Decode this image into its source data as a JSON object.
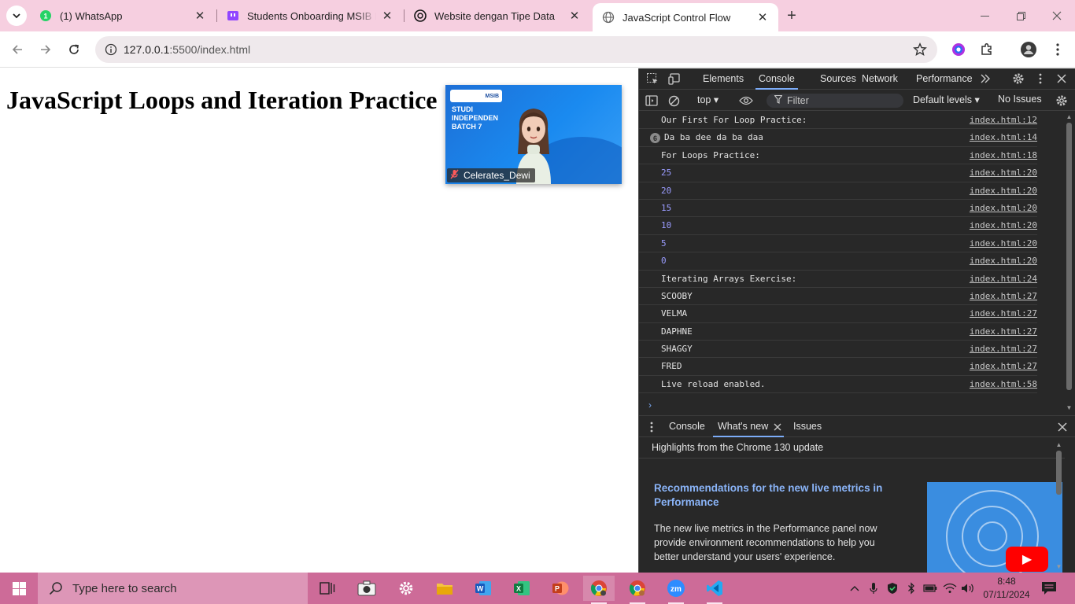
{
  "browser": {
    "tabs": [
      {
        "title": "(1) WhatsApp",
        "icon": "whatsapp-icon"
      },
      {
        "title": "Students Onboarding MSIB Bat",
        "icon": "twitch-icon"
      },
      {
        "title": "Website dengan Tipe Data",
        "icon": "openai-icon"
      },
      {
        "title": "JavaScript Control Flow",
        "icon": "globe-icon",
        "active": true
      }
    ],
    "whatsapp_badge": "1",
    "url_host": "127.0.0.1",
    "url_path": ":5500/index.html"
  },
  "page": {
    "heading": "JavaScript Loops and Iteration Practice",
    "video": {
      "logo_text": "MSIB",
      "banner_text": "STUDI\nINDEPENDEN\nBATCH 7",
      "participant_name": "Celerates_Dewi"
    }
  },
  "devtools": {
    "panel_tabs": [
      "Elements",
      "Console",
      "Sources",
      "Network",
      "Performance"
    ],
    "active_tab": "Console",
    "context": "top",
    "filter_placeholder": "Filter",
    "levels": "Default levels",
    "issues": "No Issues",
    "logs": [
      {
        "msg": "Our First For Loop Practice:",
        "src": "index.html:12"
      },
      {
        "msg": "Da ba dee da ba daa",
        "src": "index.html:14",
        "repeat": "6"
      },
      {
        "msg": "For Loops Practice:",
        "src": "index.html:18"
      },
      {
        "msg": "25",
        "src": "index.html:20",
        "num": true
      },
      {
        "msg": "20",
        "src": "index.html:20",
        "num": true
      },
      {
        "msg": "15",
        "src": "index.html:20",
        "num": true
      },
      {
        "msg": "10",
        "src": "index.html:20",
        "num": true
      },
      {
        "msg": "5",
        "src": "index.html:20",
        "num": true
      },
      {
        "msg": "0",
        "src": "index.html:20",
        "num": true
      },
      {
        "msg": "Iterating Arrays Exercise:",
        "src": "index.html:24"
      },
      {
        "msg": "SCOOBY",
        "src": "index.html:27"
      },
      {
        "msg": "VELMA",
        "src": "index.html:27"
      },
      {
        "msg": "DAPHNE",
        "src": "index.html:27"
      },
      {
        "msg": "SHAGGY",
        "src": "index.html:27"
      },
      {
        "msg": "FRED",
        "src": "index.html:27"
      },
      {
        "msg": "Live reload enabled.",
        "src": "index.html:58"
      }
    ],
    "drawer_tabs": [
      "Console",
      "What's new",
      "Issues"
    ],
    "whats_new": {
      "highlights": "Highlights from the Chrome 130 update",
      "title": "Recommendations for the new live metrics in Performance",
      "body": "The new live metrics in the Performance panel now provide environment recommendations to help you better understand your users' experience."
    }
  },
  "taskbar": {
    "search_placeholder": "Type here to search",
    "time": "8:48",
    "date": "07/11/2024"
  },
  "colors": {
    "tabstrip": "#f6cfe0",
    "taskbar": "#cd6b98",
    "devtools_bg": "#282828",
    "link_blue": "#8ab4f8"
  }
}
